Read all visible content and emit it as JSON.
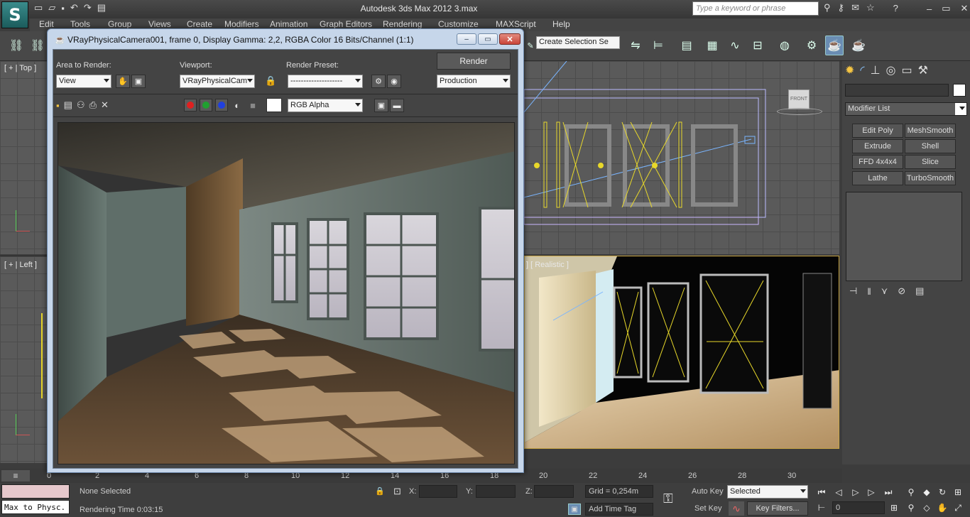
{
  "app": {
    "title": "Autodesk 3ds Max  2012     3.max",
    "search_placeholder": "Type a keyword or phrase",
    "logo": "S"
  },
  "menu": [
    "Edit",
    "Tools",
    "Group",
    "Views",
    "Create",
    "Modifiers",
    "Animation",
    "Graph Editors",
    "Rendering",
    "Customize",
    "MAXScript",
    "Help"
  ],
  "toolbar": {
    "selection_set": "Create Selection Se"
  },
  "viewports": {
    "top_label": "[ + | Top ]",
    "left_label": "[ + | Left ]",
    "persp_label": "] [ Realistic ]",
    "viewcube_label": "FRONT"
  },
  "command_panel": {
    "modifier_list": "Modifier List",
    "modifier_buttons": [
      "Edit Poly",
      "MeshSmooth",
      "Extrude",
      "Shell",
      "FFD 4x4x4",
      "Slice",
      "Lathe",
      "TurboSmooth"
    ]
  },
  "render_window": {
    "title": "VRayPhysicalCamera001, frame 0, Display Gamma: 2,2, RGBA Color 16 Bits/Channel (1:1)",
    "area_label": "Area to Render:",
    "area_value": "View",
    "viewport_label": "Viewport:",
    "viewport_value": "VRayPhysicalCam",
    "preset_label": "Render Preset:",
    "preset_value": "--------------------",
    "render_button": "Render",
    "production": "Production",
    "channel": "RGB Alpha"
  },
  "timeline": {
    "ticks": [
      "0",
      "2",
      "4",
      "6",
      "8",
      "10",
      "12",
      "14",
      "16",
      "18",
      "20",
      "22",
      "24",
      "26",
      "28",
      "30"
    ]
  },
  "status": {
    "maxscript": "Max to Physc.",
    "selection": "None Selected",
    "render_time": "Rendering Time  0:03:15",
    "x_label": "X:",
    "y_label": "Y:",
    "z_label": "Z:",
    "grid": "Grid = 0,254m",
    "add_time_tag": "Add Time Tag",
    "auto_key": "Auto Key",
    "set_key": "Set Key",
    "key_mode": "Selected",
    "key_filters": "Key Filters...",
    "frame": "0"
  },
  "colors": {
    "accent": "#1b5c5c",
    "window_frame": "#c6d6ea",
    "close_button": "#c9453a",
    "highlight_yellow": "#e8d82a"
  }
}
